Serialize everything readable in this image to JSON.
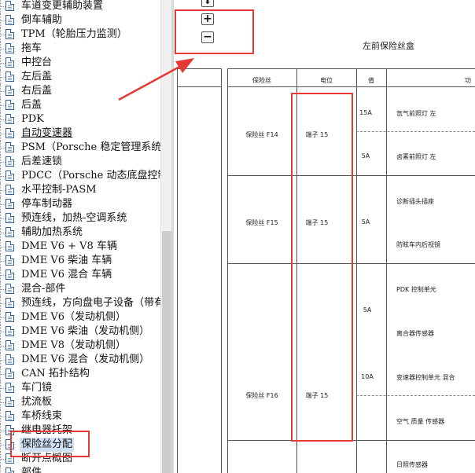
{
  "tree": {
    "items": [
      {
        "label": "车道变更辅助装置",
        "style": ""
      },
      {
        "label": "倒车辅助",
        "style": ""
      },
      {
        "label": "TPM（轮胎压力监测）",
        "style": ""
      },
      {
        "label": "拖车",
        "style": ""
      },
      {
        "label": "中控台",
        "style": ""
      },
      {
        "label": "左后盖",
        "style": ""
      },
      {
        "label": "右后盖",
        "style": ""
      },
      {
        "label": "后盖",
        "style": ""
      },
      {
        "label": "PDK",
        "style": ""
      },
      {
        "label": "自动变速器",
        "style": "link"
      },
      {
        "label": "PSM（Porsche 稳定管理系统）",
        "style": ""
      },
      {
        "label": "后差速锁",
        "style": ""
      },
      {
        "label": "PDCC（Porsche 动态底盘控制）",
        "style": ""
      },
      {
        "label": "水平控制-PASM",
        "style": ""
      },
      {
        "label": "停车制动器",
        "style": ""
      },
      {
        "label": "预连线，加热-空调系统",
        "style": ""
      },
      {
        "label": "辅助加热系统",
        "style": ""
      },
      {
        "label": "DME V6 + V8 车辆",
        "style": ""
      },
      {
        "label": "DME V6 柴油 车辆",
        "style": ""
      },
      {
        "label": "DME V6 混合 车辆",
        "style": ""
      },
      {
        "label": "混合-部件",
        "style": ""
      },
      {
        "label": "预连线，方向盘电子设备（带有",
        "style": ""
      },
      {
        "label": "DME V6（发动机侧）",
        "style": ""
      },
      {
        "label": "DME V6 柴油（发动机侧）",
        "style": ""
      },
      {
        "label": "DME V8（发动机侧）",
        "style": ""
      },
      {
        "label": "DME V6 混合（发动机侧）",
        "style": ""
      },
      {
        "label": "CAN 拓扑结构",
        "style": ""
      },
      {
        "label": "车门镜",
        "style": ""
      },
      {
        "label": "扰流板",
        "style": ""
      },
      {
        "label": "车桥线束",
        "style": ""
      },
      {
        "label": "继电器托架",
        "style": ""
      },
      {
        "label": "保险丝分配",
        "style": "selected"
      },
      {
        "label": "断开点概图",
        "style": ""
      },
      {
        "label": "部件",
        "style": ""
      }
    ]
  },
  "toolbar": {
    "zoom_in": "+",
    "zoom_out": "−",
    "down": "⬇"
  },
  "document": {
    "title": "左前保险丝盒",
    "headers": [
      "保险丝",
      "电位",
      "值",
      "功"
    ],
    "rows": [
      {
        "fuse": "保险丝 F14",
        "terminal": "端子 15",
        "values": [
          "15A",
          "5A"
        ],
        "functions": [
          "氙气前照灯 左",
          "卤素前照灯 左"
        ]
      },
      {
        "fuse": "保险丝 F15",
        "terminal": "端子 15",
        "values": [
          "5A"
        ],
        "functions": [
          "诊断插头插座",
          "防眩车内后视镜"
        ]
      },
      {
        "fuse": "保险丝 F16",
        "terminal": "端子 15",
        "values": [
          "5A",
          "10A"
        ],
        "functions": [
          "PDK 控制单元",
          "离合器传感器",
          "变速器控制单元 混合",
          "空气 质量 传感器"
        ]
      },
      {
        "fuse": "",
        "terminal": "",
        "values": [],
        "functions": [
          "日照传感器"
        ]
      }
    ]
  },
  "colors": {
    "annotation": "#e53935",
    "selection": "#cfe0f5",
    "icon": "#2e5f9e"
  }
}
